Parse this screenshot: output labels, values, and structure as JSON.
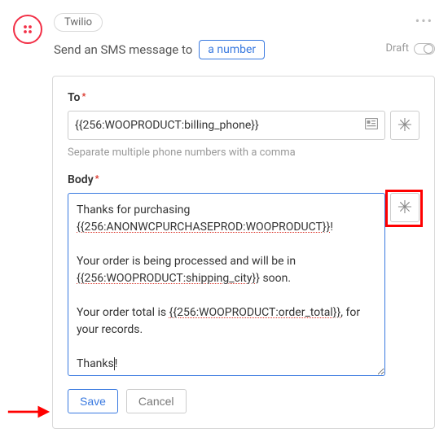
{
  "header": {
    "app_name": "Twilio",
    "description_prefix": "Send an SMS message to",
    "number_token": "a number",
    "draft_label": "Draft"
  },
  "form": {
    "to": {
      "label": "To",
      "value": "{{256:WOOPRODUCT:billing_phone}}",
      "helper": "Separate multiple phone numbers with a comma"
    },
    "body": {
      "label": "Body"
    },
    "actions": {
      "save": "Save",
      "cancel": "Cancel"
    }
  }
}
